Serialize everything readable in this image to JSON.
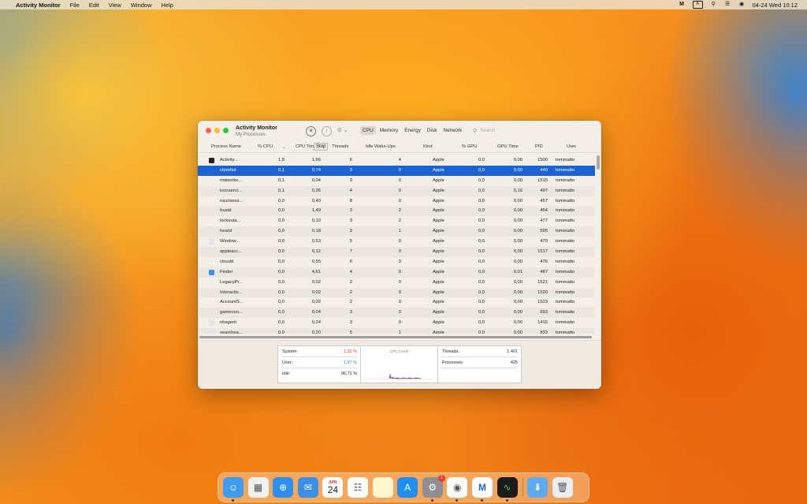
{
  "menubar": {
    "app_name": "Activity Monitor",
    "menus": [
      "File",
      "Edit",
      "View",
      "Window",
      "Help"
    ],
    "datetime": "04-24 Wed  10:12",
    "input_source": "A"
  },
  "window": {
    "title": "Activity Monitor",
    "subtitle": "My Processes",
    "tabs": [
      "CPU",
      "Memory",
      "Energy",
      "Disk",
      "Network"
    ],
    "active_tab": "CPU",
    "search_placeholder": "Search",
    "stop_tooltip": "Stop",
    "columns": {
      "name": "Process Name",
      "cpu": "% CPU",
      "cpu_time": "CPU Time",
      "threads": "Threads",
      "idle": "Idle Wake-Ups",
      "kind": "Kind",
      "gpu": "% GPU",
      "gpu_time": "GPU Time",
      "pid": "PID",
      "user": "User"
    },
    "rows": [
      {
        "name": "Activity...",
        "cpu": "1,8",
        "time": "1,66",
        "thr": "6",
        "idle": "4",
        "kind": "Apple",
        "gpu": "0,0",
        "gtime": "0,00",
        "pid": "1500",
        "user": "tommatto",
        "icon": "#222222"
      },
      {
        "name": "cfprefsd",
        "cpu": "0,1",
        "time": "0,74",
        "thr": "3",
        "idle": "0",
        "kind": "Apple",
        "gpu": "0,0",
        "gtime": "0,00",
        "pid": "440",
        "user": "tommatto",
        "icon": ""
      },
      {
        "name": "mdworke...",
        "cpu": "0,1",
        "time": "0,04",
        "thr": "3",
        "idle": "0",
        "kind": "Apple",
        "gpu": "0,0",
        "gtime": "0,00",
        "pid": "1515",
        "user": "tommatto",
        "icon": ""
      },
      {
        "name": "iconservi...",
        "cpu": "0,1",
        "time": "0,26",
        "thr": "4",
        "idle": "0",
        "kind": "Apple",
        "gpu": "0,0",
        "gtime": "0,16",
        "pid": "497",
        "user": "tommatto",
        "icon": ""
      },
      {
        "name": "nsurlsess...",
        "cpu": "0,0",
        "time": "0,40",
        "thr": "8",
        "idle": "0",
        "kind": "Apple",
        "gpu": "0,0",
        "gtime": "0,00",
        "pid": "457",
        "user": "tommatto",
        "icon": ""
      },
      {
        "name": "trustd",
        "cpu": "0,0",
        "time": "1,49",
        "thr": "3",
        "idle": "2",
        "kind": "Apple",
        "gpu": "0,0",
        "gtime": "0,00",
        "pid": "454",
        "user": "tommatto",
        "icon": ""
      },
      {
        "name": "lockouta...",
        "cpu": "0,0",
        "time": "0,10",
        "thr": "3",
        "idle": "2",
        "kind": "Apple",
        "gpu": "0,0",
        "gtime": "0,00",
        "pid": "477",
        "user": "tommatto",
        "icon": ""
      },
      {
        "name": "heard",
        "cpu": "0,0",
        "time": "0,18",
        "thr": "3",
        "idle": "1",
        "kind": "Apple",
        "gpu": "0,0",
        "gtime": "0,00",
        "pid": "595",
        "user": "tommatto",
        "icon": ""
      },
      {
        "name": "Window...",
        "cpu": "0,0",
        "time": "0,53",
        "thr": "5",
        "idle": "0",
        "kind": "Apple",
        "gpu": "0,0",
        "gtime": "0,00",
        "pid": "470",
        "user": "tommatto",
        "icon": "#e4e4e4"
      },
      {
        "name": "appleacc...",
        "cpu": "0,0",
        "time": "0,12",
        "thr": "7",
        "idle": "0",
        "kind": "Apple",
        "gpu": "0,0",
        "gtime": "0,00",
        "pid": "1517",
        "user": "tommatto",
        "icon": ""
      },
      {
        "name": "cloudd",
        "cpu": "0,0",
        "time": "0,55",
        "thr": "6",
        "idle": "0",
        "kind": "Apple",
        "gpu": "0,0",
        "gtime": "0,00",
        "pid": "476",
        "user": "tommatto",
        "icon": ""
      },
      {
        "name": "Finder",
        "cpu": "0,0",
        "time": "4,61",
        "thr": "4",
        "idle": "0",
        "kind": "Apple",
        "gpu": "0,0",
        "gtime": "0,01",
        "pid": "487",
        "user": "tommatto",
        "icon": "#3b8fe8"
      },
      {
        "name": "LegacyPr...",
        "cpu": "0,0",
        "time": "0,02",
        "thr": "2",
        "idle": "0",
        "kind": "Apple",
        "gpu": "0,0",
        "gtime": "0,00",
        "pid": "1521",
        "user": "tommatto",
        "icon": ""
      },
      {
        "name": "Interactiv...",
        "cpu": "0,0",
        "time": "0,02",
        "thr": "2",
        "idle": "0",
        "kind": "Apple",
        "gpu": "0,0",
        "gtime": "0,00",
        "pid": "1520",
        "user": "tommatto",
        "icon": ""
      },
      {
        "name": "AccountS...",
        "cpu": "0,0",
        "time": "0,02",
        "thr": "2",
        "idle": "0",
        "kind": "Apple",
        "gpu": "0,0",
        "gtime": "0,00",
        "pid": "1523",
        "user": "tommatto",
        "icon": ""
      },
      {
        "name": "gamecon...",
        "cpu": "0,0",
        "time": "0,04",
        "thr": "3",
        "idle": "0",
        "kind": "Apple",
        "gpu": "0,0",
        "gtime": "0,00",
        "pid": "693",
        "user": "tommatto",
        "icon": ""
      },
      {
        "name": "nbagent",
        "cpu": "0,0",
        "time": "0,24",
        "thr": "3",
        "idle": "0",
        "kind": "Apple",
        "gpu": "0,0",
        "gtime": "0,00",
        "pid": "1415",
        "user": "tommatto",
        "icon": "#e4e4e4"
      },
      {
        "name": "searchpa...",
        "cpu": "0,0",
        "time": "0,20",
        "thr": "5",
        "idle": "1",
        "kind": "Apple",
        "gpu": "0,0",
        "gtime": "0,00",
        "pid": "833",
        "user": "tommatto",
        "icon": ""
      }
    ],
    "selected_row": 1,
    "summary": {
      "system_label": "System:",
      "system_value": "1,32 %",
      "user_label": "User:",
      "user_value": "1,97 %",
      "idle_label": "Idle:",
      "idle_value": "96,71 %",
      "cpu_load_label": "CPU LOAD",
      "threads_label": "Threads:",
      "threads_value": "1 401",
      "processes_label": "Processes:",
      "processes_value": "425"
    }
  },
  "dock": {
    "calendar_month": "APR",
    "calendar_day": "24",
    "settings_badge": "1",
    "items": [
      {
        "name": "finder",
        "color": "#3d9bf0"
      },
      {
        "name": "launchpad",
        "color": "#f0f0f0"
      },
      {
        "name": "safari",
        "color": "#2d8ff0"
      },
      {
        "name": "mail",
        "color": "#3b8fe8"
      },
      {
        "name": "calendar",
        "color": "#ffffff"
      },
      {
        "name": "reminders",
        "color": "#ffffff"
      },
      {
        "name": "notes",
        "color": "#fff6d0"
      },
      {
        "name": "app-store",
        "color": "#1e8ff0"
      },
      {
        "name": "system-settings",
        "color": "#8e8e93"
      },
      {
        "name": "chrome",
        "color": "#ffffff"
      },
      {
        "name": "malwarebytes",
        "color": "#ffffff"
      },
      {
        "name": "activity-monitor",
        "color": "#1b1b1b"
      },
      {
        "name": "downloads-folder",
        "color": "#5eaaf0"
      },
      {
        "name": "trash",
        "color": "#e8eef2"
      }
    ]
  }
}
